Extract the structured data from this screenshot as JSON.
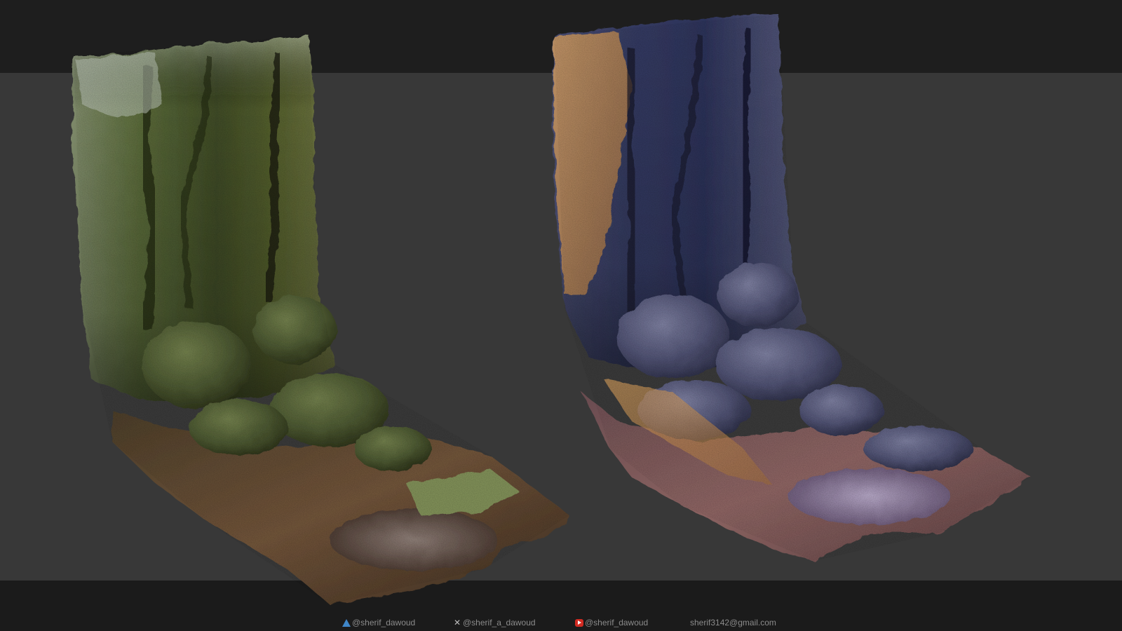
{
  "scene": {
    "subject": "Two photogrammetry-scanned rock cliff wall assets on a 3D viewport",
    "left_asset_tone": "green-olive lit",
    "right_asset_tone": "blue-violet lit with warm sun patches"
  },
  "footer": {
    "artstation": "@sherif_dawoud",
    "x_twitter": "@sherif_a_dawoud",
    "youtube": "@sherif_dawoud",
    "email": "sherif3142@gmail.com"
  },
  "colors": {
    "top_band": "#1e1e1e",
    "viewport_bg": "#383838",
    "bottom_band": "#1b1b1b",
    "footer_text": "#8b8b8b"
  }
}
